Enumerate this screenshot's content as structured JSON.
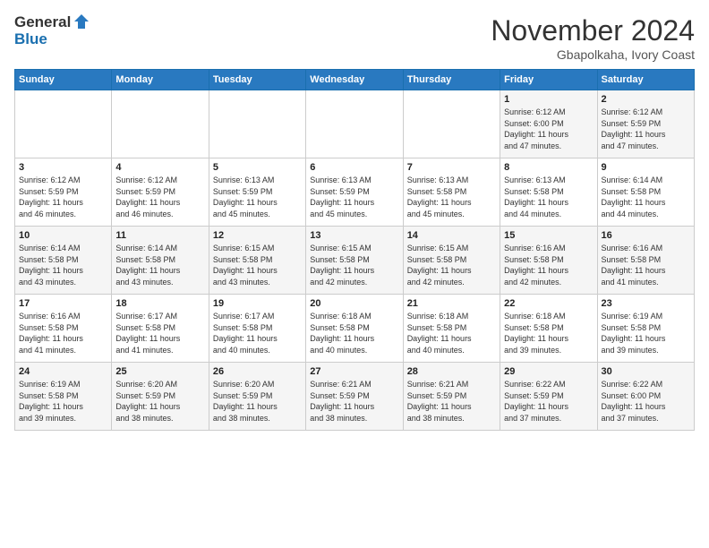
{
  "logo": {
    "line1": "General",
    "line2": "Blue"
  },
  "title": "November 2024",
  "location": "Gbapolkaha, Ivory Coast",
  "days_of_week": [
    "Sunday",
    "Monday",
    "Tuesday",
    "Wednesday",
    "Thursday",
    "Friday",
    "Saturday"
  ],
  "weeks": [
    [
      {
        "day": "",
        "info": ""
      },
      {
        "day": "",
        "info": ""
      },
      {
        "day": "",
        "info": ""
      },
      {
        "day": "",
        "info": ""
      },
      {
        "day": "",
        "info": ""
      },
      {
        "day": "1",
        "info": "Sunrise: 6:12 AM\nSunset: 6:00 PM\nDaylight: 11 hours\nand 47 minutes."
      },
      {
        "day": "2",
        "info": "Sunrise: 6:12 AM\nSunset: 5:59 PM\nDaylight: 11 hours\nand 47 minutes."
      }
    ],
    [
      {
        "day": "3",
        "info": "Sunrise: 6:12 AM\nSunset: 5:59 PM\nDaylight: 11 hours\nand 46 minutes."
      },
      {
        "day": "4",
        "info": "Sunrise: 6:12 AM\nSunset: 5:59 PM\nDaylight: 11 hours\nand 46 minutes."
      },
      {
        "day": "5",
        "info": "Sunrise: 6:13 AM\nSunset: 5:59 PM\nDaylight: 11 hours\nand 45 minutes."
      },
      {
        "day": "6",
        "info": "Sunrise: 6:13 AM\nSunset: 5:59 PM\nDaylight: 11 hours\nand 45 minutes."
      },
      {
        "day": "7",
        "info": "Sunrise: 6:13 AM\nSunset: 5:58 PM\nDaylight: 11 hours\nand 45 minutes."
      },
      {
        "day": "8",
        "info": "Sunrise: 6:13 AM\nSunset: 5:58 PM\nDaylight: 11 hours\nand 44 minutes."
      },
      {
        "day": "9",
        "info": "Sunrise: 6:14 AM\nSunset: 5:58 PM\nDaylight: 11 hours\nand 44 minutes."
      }
    ],
    [
      {
        "day": "10",
        "info": "Sunrise: 6:14 AM\nSunset: 5:58 PM\nDaylight: 11 hours\nand 43 minutes."
      },
      {
        "day": "11",
        "info": "Sunrise: 6:14 AM\nSunset: 5:58 PM\nDaylight: 11 hours\nand 43 minutes."
      },
      {
        "day": "12",
        "info": "Sunrise: 6:15 AM\nSunset: 5:58 PM\nDaylight: 11 hours\nand 43 minutes."
      },
      {
        "day": "13",
        "info": "Sunrise: 6:15 AM\nSunset: 5:58 PM\nDaylight: 11 hours\nand 42 minutes."
      },
      {
        "day": "14",
        "info": "Sunrise: 6:15 AM\nSunset: 5:58 PM\nDaylight: 11 hours\nand 42 minutes."
      },
      {
        "day": "15",
        "info": "Sunrise: 6:16 AM\nSunset: 5:58 PM\nDaylight: 11 hours\nand 42 minutes."
      },
      {
        "day": "16",
        "info": "Sunrise: 6:16 AM\nSunset: 5:58 PM\nDaylight: 11 hours\nand 41 minutes."
      }
    ],
    [
      {
        "day": "17",
        "info": "Sunrise: 6:16 AM\nSunset: 5:58 PM\nDaylight: 11 hours\nand 41 minutes."
      },
      {
        "day": "18",
        "info": "Sunrise: 6:17 AM\nSunset: 5:58 PM\nDaylight: 11 hours\nand 41 minutes."
      },
      {
        "day": "19",
        "info": "Sunrise: 6:17 AM\nSunset: 5:58 PM\nDaylight: 11 hours\nand 40 minutes."
      },
      {
        "day": "20",
        "info": "Sunrise: 6:18 AM\nSunset: 5:58 PM\nDaylight: 11 hours\nand 40 minutes."
      },
      {
        "day": "21",
        "info": "Sunrise: 6:18 AM\nSunset: 5:58 PM\nDaylight: 11 hours\nand 40 minutes."
      },
      {
        "day": "22",
        "info": "Sunrise: 6:18 AM\nSunset: 5:58 PM\nDaylight: 11 hours\nand 39 minutes."
      },
      {
        "day": "23",
        "info": "Sunrise: 6:19 AM\nSunset: 5:58 PM\nDaylight: 11 hours\nand 39 minutes."
      }
    ],
    [
      {
        "day": "24",
        "info": "Sunrise: 6:19 AM\nSunset: 5:58 PM\nDaylight: 11 hours\nand 39 minutes."
      },
      {
        "day": "25",
        "info": "Sunrise: 6:20 AM\nSunset: 5:59 PM\nDaylight: 11 hours\nand 38 minutes."
      },
      {
        "day": "26",
        "info": "Sunrise: 6:20 AM\nSunset: 5:59 PM\nDaylight: 11 hours\nand 38 minutes."
      },
      {
        "day": "27",
        "info": "Sunrise: 6:21 AM\nSunset: 5:59 PM\nDaylight: 11 hours\nand 38 minutes."
      },
      {
        "day": "28",
        "info": "Sunrise: 6:21 AM\nSunset: 5:59 PM\nDaylight: 11 hours\nand 38 minutes."
      },
      {
        "day": "29",
        "info": "Sunrise: 6:22 AM\nSunset: 5:59 PM\nDaylight: 11 hours\nand 37 minutes."
      },
      {
        "day": "30",
        "info": "Sunrise: 6:22 AM\nSunset: 6:00 PM\nDaylight: 11 hours\nand 37 minutes."
      }
    ]
  ]
}
